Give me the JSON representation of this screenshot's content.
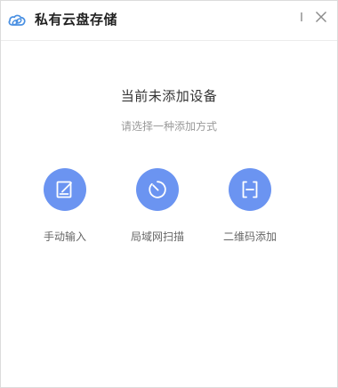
{
  "window": {
    "title": "私有云盘存储",
    "logo_icon": "cloud-link-icon",
    "minimize_icon": "minimize-icon",
    "close_icon": "close-icon"
  },
  "empty_state": {
    "headline": "当前未添加设备",
    "subline": "请选择一种添加方式"
  },
  "options": [
    {
      "label": "手动输入",
      "icon": "edit-icon"
    },
    {
      "label": "局域网扫描",
      "icon": "scan-icon"
    },
    {
      "label": "二维码添加",
      "icon": "qr-scan-icon"
    }
  ],
  "colors": {
    "accent": "#6b94f1",
    "logo": "#4a90e2"
  }
}
